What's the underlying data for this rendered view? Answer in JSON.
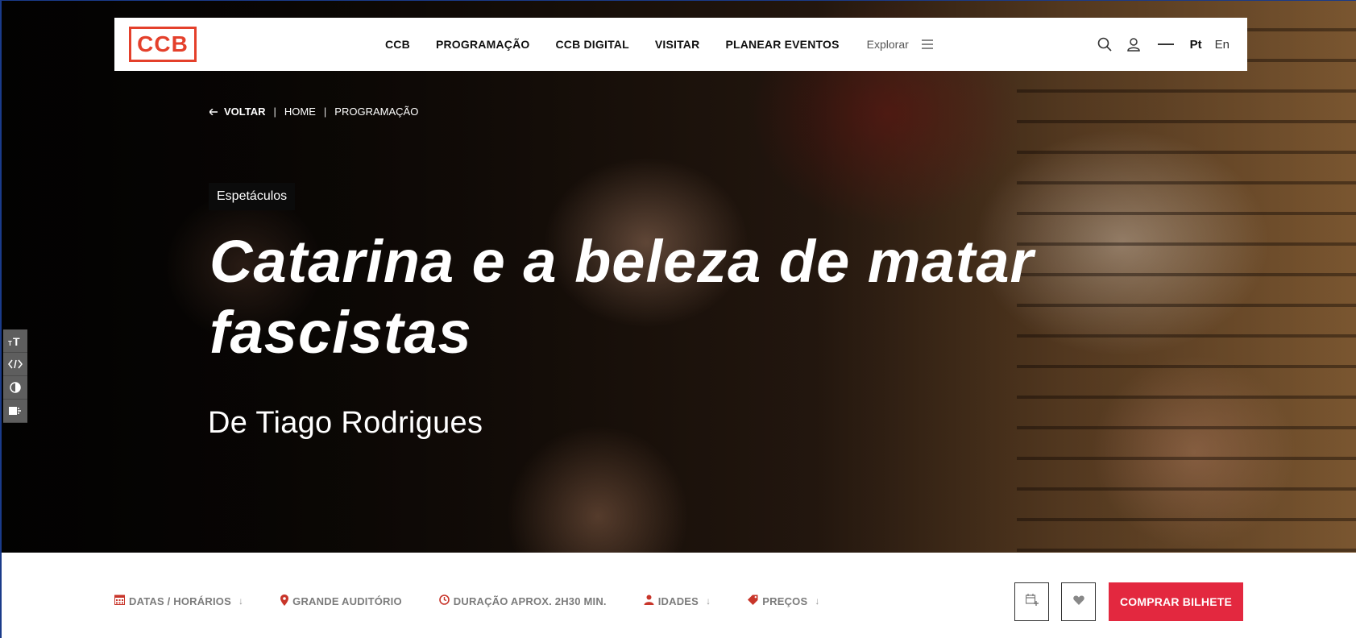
{
  "header": {
    "logo_text": "CCB",
    "nav": [
      "CCB",
      "PROGRAMAÇÃO",
      "CCB DIGITAL",
      "VISITAR",
      "PLANEAR EVENTOS"
    ],
    "explore_label": "Explorar",
    "languages": [
      {
        "label": "Pt",
        "active": true
      },
      {
        "label": "En",
        "active": false
      }
    ]
  },
  "breadcrumb": {
    "back_label": "VOLTAR",
    "items": [
      "HOME",
      "PROGRAMAÇÃO"
    ]
  },
  "event": {
    "category": "Espetáculos",
    "title": "Catarina e a beleza de matar fascistas",
    "author": "De Tiago Rodrigues"
  },
  "info": {
    "dates_label": "DATAS / HORÁRIOS",
    "venue_label": "GRANDE AUDITÓRIO",
    "duration_label": "DURAÇÃO APROX. 2H30 MIN.",
    "ages_label": "IDADES",
    "prices_label": "PREÇOS"
  },
  "actions": {
    "buy_label": "COMPRAR BILHETE"
  },
  "colors": {
    "brand_red": "#e4402b",
    "buy_red": "#e3283f",
    "icon_red": "#c8352a"
  },
  "icons": {
    "search": "search-icon",
    "user": "user-icon",
    "menu": "menu-icon",
    "calendar": "calendar-icon",
    "location": "location-pin-icon",
    "clock": "clock-icon",
    "person": "person-icon",
    "price_tag": "price-tag-icon",
    "add_calendar": "calendar-add-icon",
    "heart": "heart-icon"
  }
}
